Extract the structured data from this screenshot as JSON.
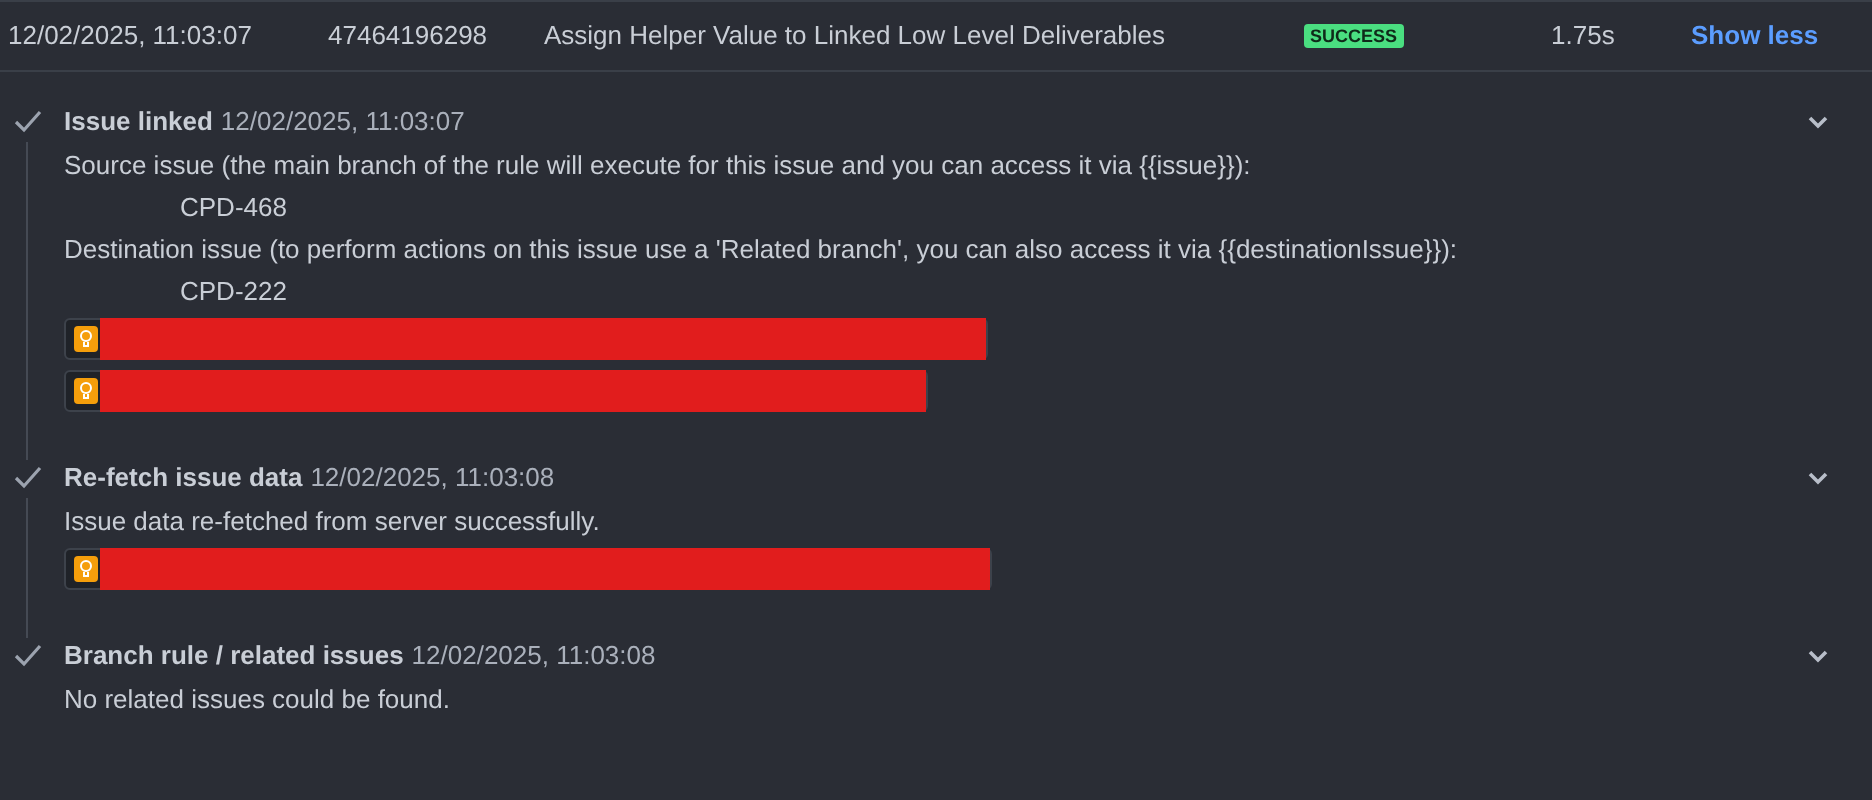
{
  "header": {
    "date": "12/02/2025, 11:03:07",
    "id": "47464196298",
    "rule": "Assign Helper Value to Linked Low Level Deliverables",
    "status": "SUCCESS",
    "duration": "1.75s",
    "toggle": "Show less"
  },
  "steps": [
    {
      "title": "Issue linked",
      "time": "12/02/2025, 11:03:07",
      "expanded": true,
      "lines": [
        {
          "kind": "text",
          "text": "Source issue (the main branch of the rule will execute for this issue and you can access it via {{issue}}):"
        },
        {
          "kind": "value",
          "text": "CPD-468"
        },
        {
          "kind": "text",
          "text": "Destination issue (to perform actions on this issue use a 'Related branch', you can also access it via {{destinationIssue}}):"
        },
        {
          "kind": "value",
          "text": "CPD-222"
        },
        {
          "kind": "log"
        },
        {
          "kind": "log"
        }
      ]
    },
    {
      "title": "Re-fetch issue data",
      "time": "12/02/2025, 11:03:08",
      "expanded": true,
      "lines": [
        {
          "kind": "text",
          "text": "Issue data re-fetched from server successfully."
        },
        {
          "kind": "log"
        }
      ]
    },
    {
      "title": "Branch rule / related issues",
      "time": "12/02/2025, 11:03:08",
      "expanded": true,
      "lines": [
        {
          "kind": "text",
          "text": "No related issues could be found."
        }
      ]
    }
  ]
}
